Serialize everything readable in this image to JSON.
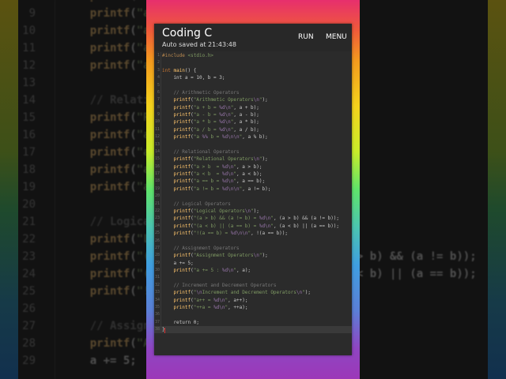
{
  "app": {
    "title": "Coding C",
    "subtitle": "Auto saved at 21:43:48",
    "run_label": "RUN",
    "menu_label": "MENU"
  },
  "colors": {
    "keyword": "#cc7832",
    "function": "#ffc66d",
    "string": "#7f9a63",
    "comment": "#777777",
    "number": "#6897bb",
    "format": "#9876aa"
  },
  "code": {
    "current_line": 38,
    "lines": [
      "#include <stdio.h>",
      "",
      "int main() {",
      "    int a = 10, b = 3;",
      "",
      "    // Arithmetic Operators",
      "    printf(\"Arithmetic Operators\\n\");",
      "    printf(\"a + b = %d\\n\", a + b);",
      "    printf(\"a - b = %d\\n\", a - b);",
      "    printf(\"a * b = %d\\n\", a * b);",
      "    printf(\"a / b = %d\\n\", a / b);",
      "    printf(\"a %% b = %d\\n\\n\", a % b);",
      "",
      "    // Relational Operators",
      "    printf(\"Relational Operators\\n\");",
      "    printf(\"a > b  = %d\\n\", a > b);",
      "    printf(\"a < b  = %d\\n\", a < b);",
      "    printf(\"a == b = %d\\n\", a == b);",
      "    printf(\"a != b = %d\\n\\n\", a != b);",
      "",
      "    // Logical Operators",
      "    printf(\"Logical Operators\\n\");",
      "    printf(\"(a > b) && (a != b) = %d\\n\", (a > b) && (a != b));",
      "    printf(\"(a < b) || (a == b) = %d\\n\", (a < b) || (a == b));",
      "    printf(\"!(a == b) = %d\\n\\n\", !(a == b));",
      "",
      "    // Assignment Operators",
      "    printf(\"Assignment Operators\\n\");",
      "    a += 5;",
      "    printf(\"a += 5 : %d\\n\", a);",
      "",
      "    // Increment and Decrement Operators",
      "    printf(\"\\nIncrement and Decrement Operators\\n\");",
      "    printf(\"a++ = %d\\n\", a++);",
      "    printf(\"++a = %d\\n\", ++a);",
      "",
      "    return 0;",
      "}"
    ]
  }
}
